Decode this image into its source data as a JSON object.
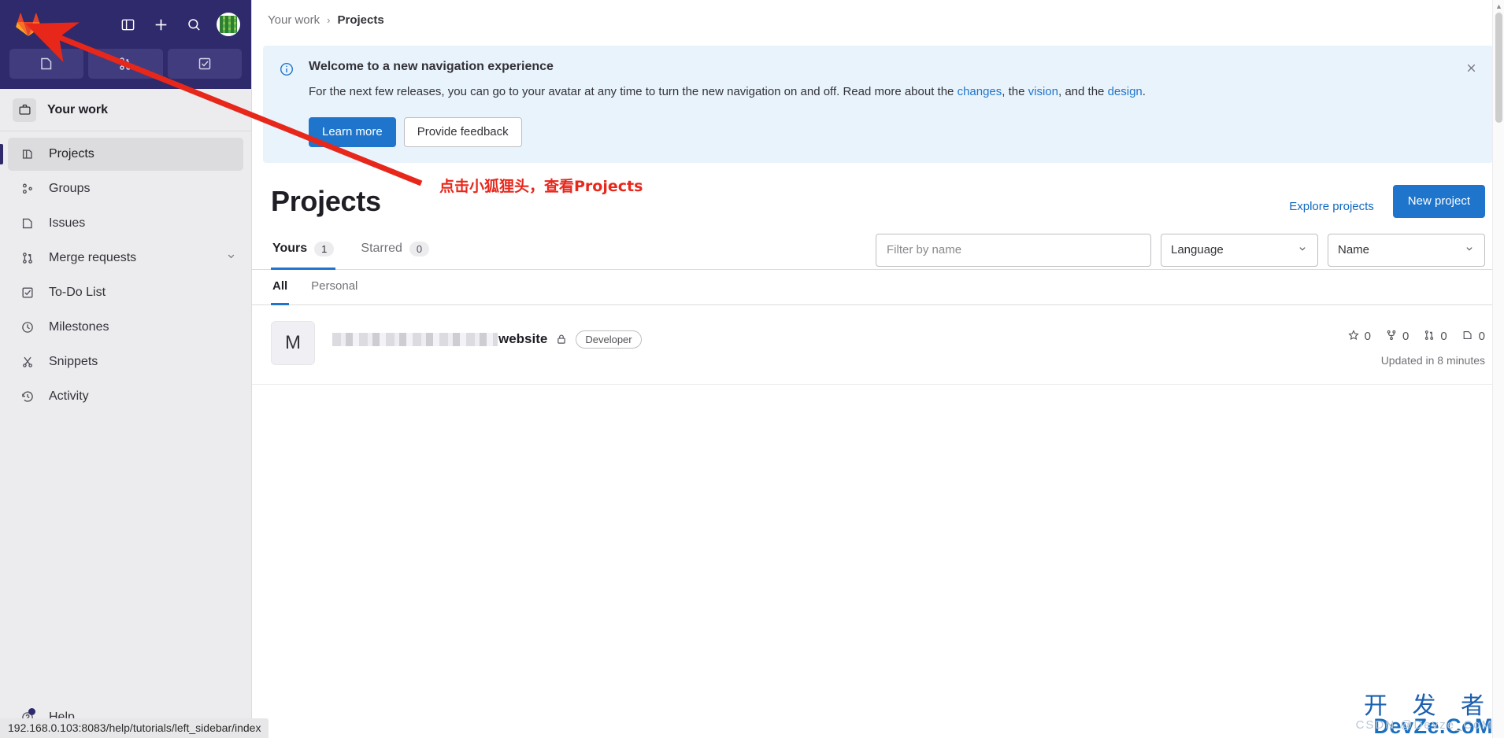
{
  "topbar": {
    "logo_icon": "gitlab-fox-logo",
    "sidebar_toggle_icon": "panel-toggle-icon",
    "new_icon": "plus-icon",
    "search_icon": "search-icon",
    "avatar_icon": "user-avatar",
    "pinned": [
      {
        "name": "issues",
        "icon": "issues-icon"
      },
      {
        "name": "merge-requests",
        "icon": "merge-request-icon"
      },
      {
        "name": "todo-list",
        "icon": "todo-check-icon"
      }
    ]
  },
  "sidebar": {
    "context_label": "Your work",
    "context_icon": "work-briefcase-icon",
    "context_chevron": "chevron-down-icon",
    "items": [
      {
        "label": "Projects",
        "icon": "project-icon",
        "active": true,
        "chevron": false
      },
      {
        "label": "Groups",
        "icon": "group-icon",
        "active": false,
        "chevron": false
      },
      {
        "label": "Issues",
        "icon": "issues-icon",
        "active": false,
        "chevron": false
      },
      {
        "label": "Merge requests",
        "icon": "merge-request-icon",
        "active": false,
        "chevron": true
      },
      {
        "label": "To-Do List",
        "icon": "todo-check-icon",
        "active": false,
        "chevron": false
      },
      {
        "label": "Milestones",
        "icon": "clock-icon",
        "active": false,
        "chevron": false
      },
      {
        "label": "Snippets",
        "icon": "snippet-scissors-icon",
        "active": false,
        "chevron": false
      },
      {
        "label": "Activity",
        "icon": "history-icon",
        "active": false,
        "chevron": false
      }
    ],
    "help": {
      "label": "Help",
      "icon": "help-question-icon",
      "has_notification": true
    }
  },
  "breadcrumb": {
    "parent": "Your work",
    "separator": "›",
    "current": "Projects"
  },
  "alert": {
    "icon": "info-circle-icon",
    "title": "Welcome to a new navigation experience",
    "text_before": "For the next few releases, you can go to your avatar at any time to turn the new navigation on and off. Read more about the ",
    "link1": "changes",
    "text_mid1": ", the ",
    "link2": "vision",
    "text_mid2": ", and the ",
    "link3": "design",
    "text_end": ".",
    "primary_button": "Learn more",
    "secondary_button": "Provide feedback",
    "close_icon": "close-x-icon"
  },
  "page": {
    "title": "Projects",
    "explore_link": "Explore projects",
    "new_project_button": "New project"
  },
  "tabs": [
    {
      "label": "Yours",
      "badge": "1",
      "active": true
    },
    {
      "label": "Starred",
      "badge": "0",
      "active": false
    }
  ],
  "filters": {
    "search_placeholder": "Filter by name",
    "search_value": "",
    "language_select": "Language",
    "sort_select": "Name",
    "chevron_icon": "chevron-down-icon"
  },
  "subtabs": [
    {
      "label": "All",
      "active": true
    },
    {
      "label": "Personal",
      "active": false
    }
  ],
  "project": {
    "avatar_letter": "M",
    "name_redacted": true,
    "name_visible": "website",
    "visibility_icon": "lock-icon",
    "role_badge": "Developer",
    "stats": [
      {
        "icon": "star-icon",
        "value": "0"
      },
      {
        "icon": "fork-icon",
        "value": "0"
      },
      {
        "icon": "merge-request-icon",
        "value": "0"
      },
      {
        "icon": "issues-icon",
        "value": "0"
      }
    ],
    "updated": "Updated in 8 minutes"
  },
  "annotation": {
    "text": "点击小狐狸头，查看Projects",
    "color": "#e8271b"
  },
  "status_bar": {
    "url": "192.168.0.103:8083/help/tutorials/left_sidebar/index"
  },
  "watermark": {
    "cn": "开 发 者",
    "en": "DevZe.CoM",
    "sub": "CSDN @Devze_CoM"
  },
  "colors": {
    "brand_navy": "#2f2a6b",
    "accent_blue": "#1f75cb",
    "link_blue": "#1068bf",
    "sidebar_bg": "#ececef",
    "alert_bg": "#e9f3fc",
    "annotation_red": "#e8271b"
  }
}
